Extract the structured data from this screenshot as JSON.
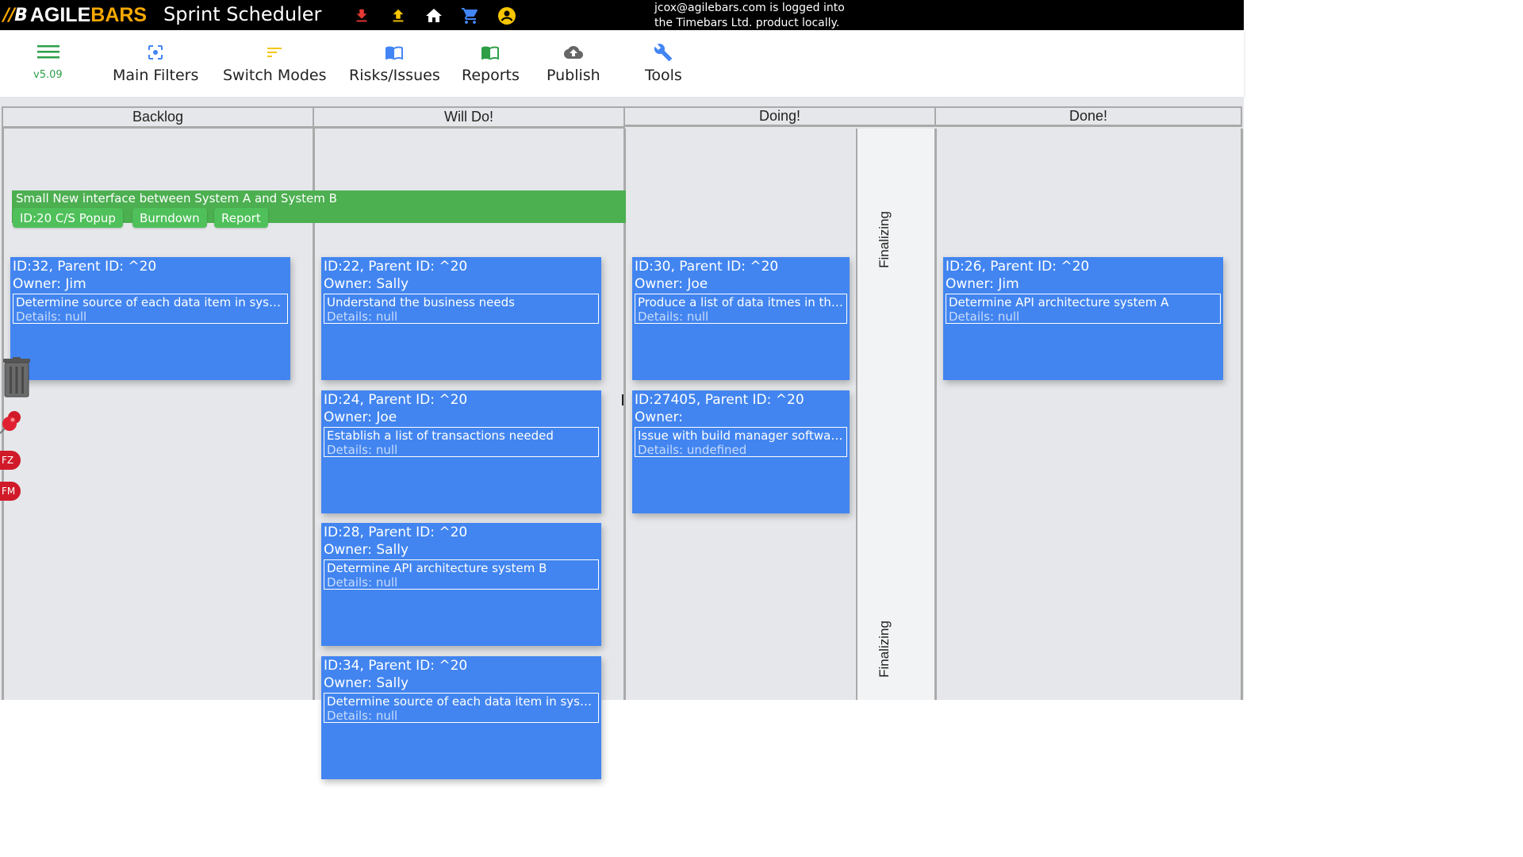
{
  "topbar": {
    "brand_agile": "AGILE",
    "brand_bars": "BARS",
    "app_title": "Sprint Scheduler",
    "login_line1": "jcox@agilebars.com is logged into",
    "login_line2": "the Timebars Ltd. product locally.",
    "icons": [
      "download-icon",
      "upload-icon",
      "home-icon",
      "cart-icon",
      "account-icon"
    ],
    "download_color": "#e53935",
    "upload_color": "#f7c600"
  },
  "toolbar": {
    "version": "v5.09",
    "items": [
      {
        "label": "Main Filters",
        "icon": "filter-focus-icon",
        "color": "#4285f4"
      },
      {
        "label": "Switch Modes",
        "icon": "sort-lines-icon",
        "color": "#f7c600"
      },
      {
        "label": "Risks/Issues",
        "icon": "book-icon",
        "color": "#4285f4"
      },
      {
        "label": "Reports",
        "icon": "book-icon",
        "color": "#2e9e47"
      },
      {
        "label": "Publish",
        "icon": "cloud-upload-icon",
        "color": "#666666"
      },
      {
        "label": "Tools",
        "icon": "wrench-icon",
        "color": "#4285f4"
      }
    ]
  },
  "board": {
    "columns": [
      "Backlog",
      "Will Do!",
      "Doing!",
      "Done!"
    ],
    "finalizing_label": "Finalizing",
    "story": {
      "title": "Small New interface between System A and System B",
      "buttons": [
        "ID:20 C/S Popup",
        "Burndown",
        "Report"
      ]
    },
    "cards": [
      {
        "id_line": "ID:32, Parent ID: ^20",
        "owner": "Owner: Jim",
        "desc": "Determine source of each data item in system A and system B",
        "details": "Details: null"
      },
      {
        "id_line": "ID:22, Parent ID: ^20",
        "owner": "Owner: Sally",
        "desc": "Understand the business needs",
        "details": "Details: null"
      },
      {
        "id_line": "ID:30, Parent ID: ^20",
        "owner": "Owner: Joe",
        "desc": "Produce a list of data itmes in the system",
        "details": "Details: null"
      },
      {
        "id_line": "ID:26, Parent ID: ^20",
        "owner": "Owner: Jim",
        "desc": "Determine API architecture system A",
        "details": "Details: null"
      },
      {
        "id_line": "ID:24, Parent ID: ^20",
        "owner": "Owner: Joe",
        "desc": "Establish a list of transactions needed",
        "details": "Details: null"
      },
      {
        "id_line": "ID:27405, Parent ID: ^20",
        "owner": "Owner:",
        "desc": "Issue with build manager software.",
        "details": "Details: undefined"
      },
      {
        "id_line": "ID:28, Parent ID: ^20",
        "owner": "Owner: Sally",
        "desc": "Determine API architecture system B",
        "details": "Details: null"
      },
      {
        "id_line": "ID:34, Parent ID: ^20",
        "owner": "Owner: Sally",
        "desc": "Determine source of each data item in system",
        "details": "Details: null"
      }
    ],
    "side_tags": [
      "FZ",
      "FM"
    ]
  }
}
